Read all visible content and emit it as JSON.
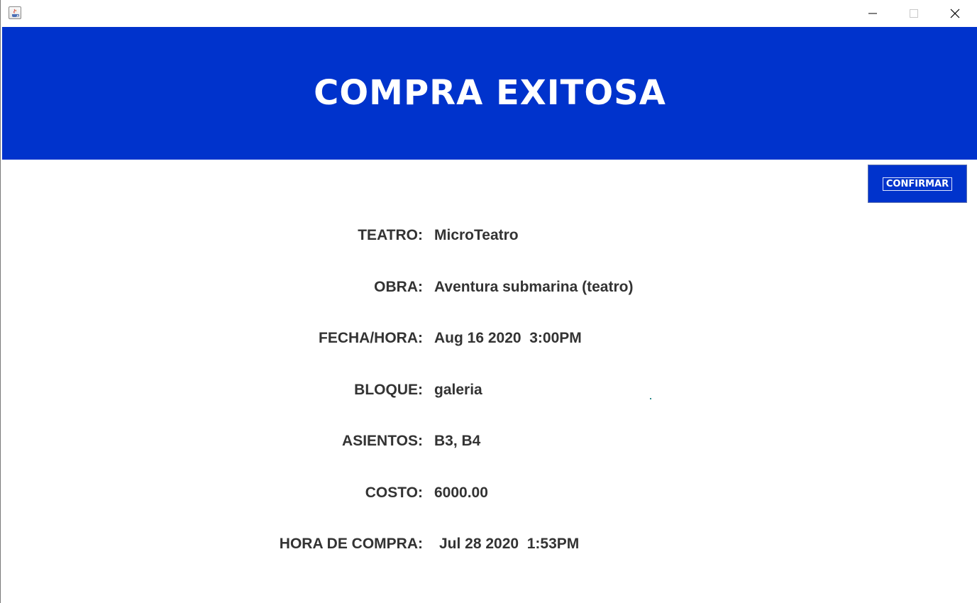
{
  "window": {
    "controls": [
      "minimize-icon",
      "maximize-icon",
      "close-icon"
    ]
  },
  "header": {
    "title": "COMPRA EXITOSA",
    "background": "#0033cc",
    "text_color": "#ffffff"
  },
  "actions": {
    "confirm_label": "CONFIRMAR"
  },
  "details": {
    "teatro": {
      "label": "TEATRO:",
      "value": "MicroTeatro"
    },
    "obra": {
      "label": "OBRA:",
      "value": "Aventura submarina (teatro)"
    },
    "fecha_hora": {
      "label": "FECHA/HORA:",
      "value": "Aug 16 2020  3:00PM"
    },
    "bloque": {
      "label": "BLOQUE:",
      "value": "galeria"
    },
    "asientos": {
      "label": "ASIENTOS:",
      "value": "B3, B4"
    },
    "costo": {
      "label": "COSTO:",
      "value": "6000.00"
    },
    "hora_compra": {
      "label": "HORA DE COMPRA:",
      "value": "Jul 28 2020  1:53PM"
    }
  },
  "colors": {
    "accent": "#0033cc",
    "text": "#333333"
  }
}
